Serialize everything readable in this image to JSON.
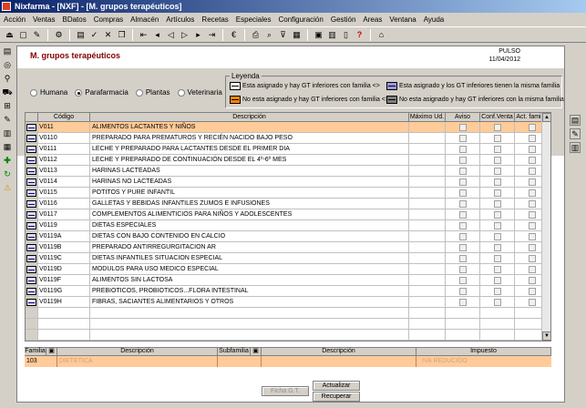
{
  "window": {
    "title": "Nixfarma - [NXF] - [M. grupos terapéuticos]"
  },
  "menu": [
    "Acción",
    "Ventas",
    "BDatos",
    "Compras",
    "Almacén",
    "Artículos",
    "Recetas",
    "Especiales",
    "Configuración",
    "Gestión",
    "Areas",
    "Ventana",
    "Ayuda"
  ],
  "header": {
    "title": "M. grupos terapéuticos",
    "user": "PULSO",
    "date": "11/04/2012"
  },
  "radios": [
    {
      "label": "Humana",
      "selected": false
    },
    {
      "label": "Parafarmacia",
      "selected": true
    },
    {
      "label": "Plantas",
      "selected": false
    },
    {
      "label": "Veterinaria",
      "selected": false
    }
  ],
  "legend": {
    "title": "Leyenda",
    "items": [
      "Esta asignado y hay GT inferiores con familia <>",
      "Esta asignado y los GT inferiores tienen la misma familia",
      "No esta asignado y hay GT inferiores con familia <>",
      "No esta asignado y hay GT inferiores con la misma familia"
    ]
  },
  "grid": {
    "columns": [
      "Código",
      "Descripción",
      "Máximo Ud.",
      "Aviso",
      "Conf.Venta",
      "Act. familia"
    ],
    "rows": [
      {
        "code": "V011",
        "desc": "ALIMENTOS LACTANTES Y NIÑOS"
      },
      {
        "code": "V0110",
        "desc": "PREPARADO PARA PREMATUROS Y RECIÉN NACIDO BAJO PESO"
      },
      {
        "code": "V0111",
        "desc": "LECHE Y PREPARADO PARA LACTANTES DESDE EL PRIMER DIA"
      },
      {
        "code": "V0112",
        "desc": "LECHE Y PREPARADO DE CONTINUACIÓN DESDE EL 4º-6º MES"
      },
      {
        "code": "V0113",
        "desc": "HARINAS LACTEADAS"
      },
      {
        "code": "V0114",
        "desc": "HARINAS NO LACTEADAS"
      },
      {
        "code": "V0115",
        "desc": "POTITOS Y PURE INFANTIL"
      },
      {
        "code": "V0116",
        "desc": "GALLETAS Y BEBIDAS INFANTILES ZUMOS E INFUSIONES"
      },
      {
        "code": "V0117",
        "desc": "COMPLEMENTOS ALIMENTICIOS PARA NIÑOS Y ADOLESCENTES"
      },
      {
        "code": "V0119",
        "desc": "DIETAS ESPECIALES"
      },
      {
        "code": "V0119A",
        "desc": "DIETAS CON BAJO CONTENIDO EN CALCIO"
      },
      {
        "code": "V0119B",
        "desc": "PREPARADO ANTIRREGURGITACION AR"
      },
      {
        "code": "V0119C",
        "desc": "DIETAS INFANTILES SITUACION ESPECIAL"
      },
      {
        "code": "V0119D",
        "desc": "MODULOS PARA USO MEDICO ESPECIAL"
      },
      {
        "code": "V0119F",
        "desc": "ALIMENTOS SIN LACTOSA"
      },
      {
        "code": "V0119G",
        "desc": "PREBIOTICOS, PROBIOTICOS...FLORA INTESTINAL"
      },
      {
        "code": "V0119H",
        "desc": "FIBRAS, SACIANTES ALIMENTARIOS Y OTROS"
      }
    ]
  },
  "footer": {
    "columns": [
      "Familia",
      "Descripción",
      "Subfamilia",
      "Descripción",
      "Impuesto"
    ],
    "values": {
      "familia": "103",
      "descripcion": "DIETETICA",
      "subfamilia": "",
      "subdesc": "",
      "impuesto": "IVA REDUCIDO"
    }
  },
  "buttons": {
    "ficha": "Ficha G.T.",
    "actualizar": "Actualizar",
    "recuperar": "Recuperar"
  },
  "colors": {
    "selected_row": "#ffcc99",
    "title": "#800000"
  }
}
